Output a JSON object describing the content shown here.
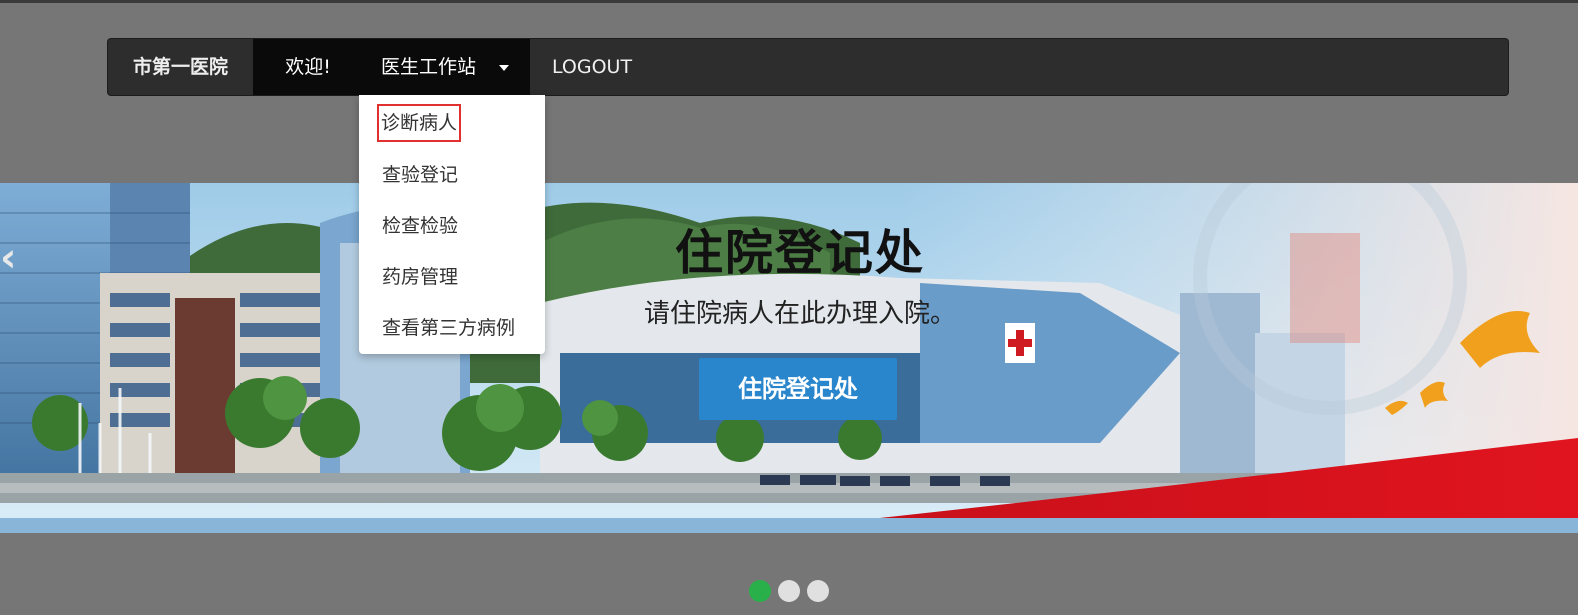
{
  "navbar": {
    "brand": "市第一医院",
    "welcome": "欢迎!",
    "doctor_menu": "医生工作站",
    "logout": "LOGOUT"
  },
  "dropdown": {
    "items": [
      {
        "label": "诊断病人",
        "highlighted": true
      },
      {
        "label": "查验登记"
      },
      {
        "label": "检查检验"
      },
      {
        "label": "药房管理"
      },
      {
        "label": "查看第三方病例"
      }
    ]
  },
  "carousel": {
    "title": "住院登记处",
    "subtitle": "请住院病人在此办理入院。",
    "button": "住院登记处",
    "prev_icon": "chevron-left-icon",
    "indicators": [
      {
        "active": true,
        "color": "#2ab04a"
      },
      {
        "active": false,
        "color": "#e0e0e0"
      },
      {
        "active": false,
        "color": "#e0e0e0"
      }
    ]
  },
  "colors": {
    "page_bg": "#767676",
    "navbar_bg": "#2d2d2d",
    "active_nav_bg": "#0a0a0a",
    "button_blue": "#2a86cc",
    "highlight_border": "#e03030",
    "indicator_active": "#2ab04a"
  }
}
